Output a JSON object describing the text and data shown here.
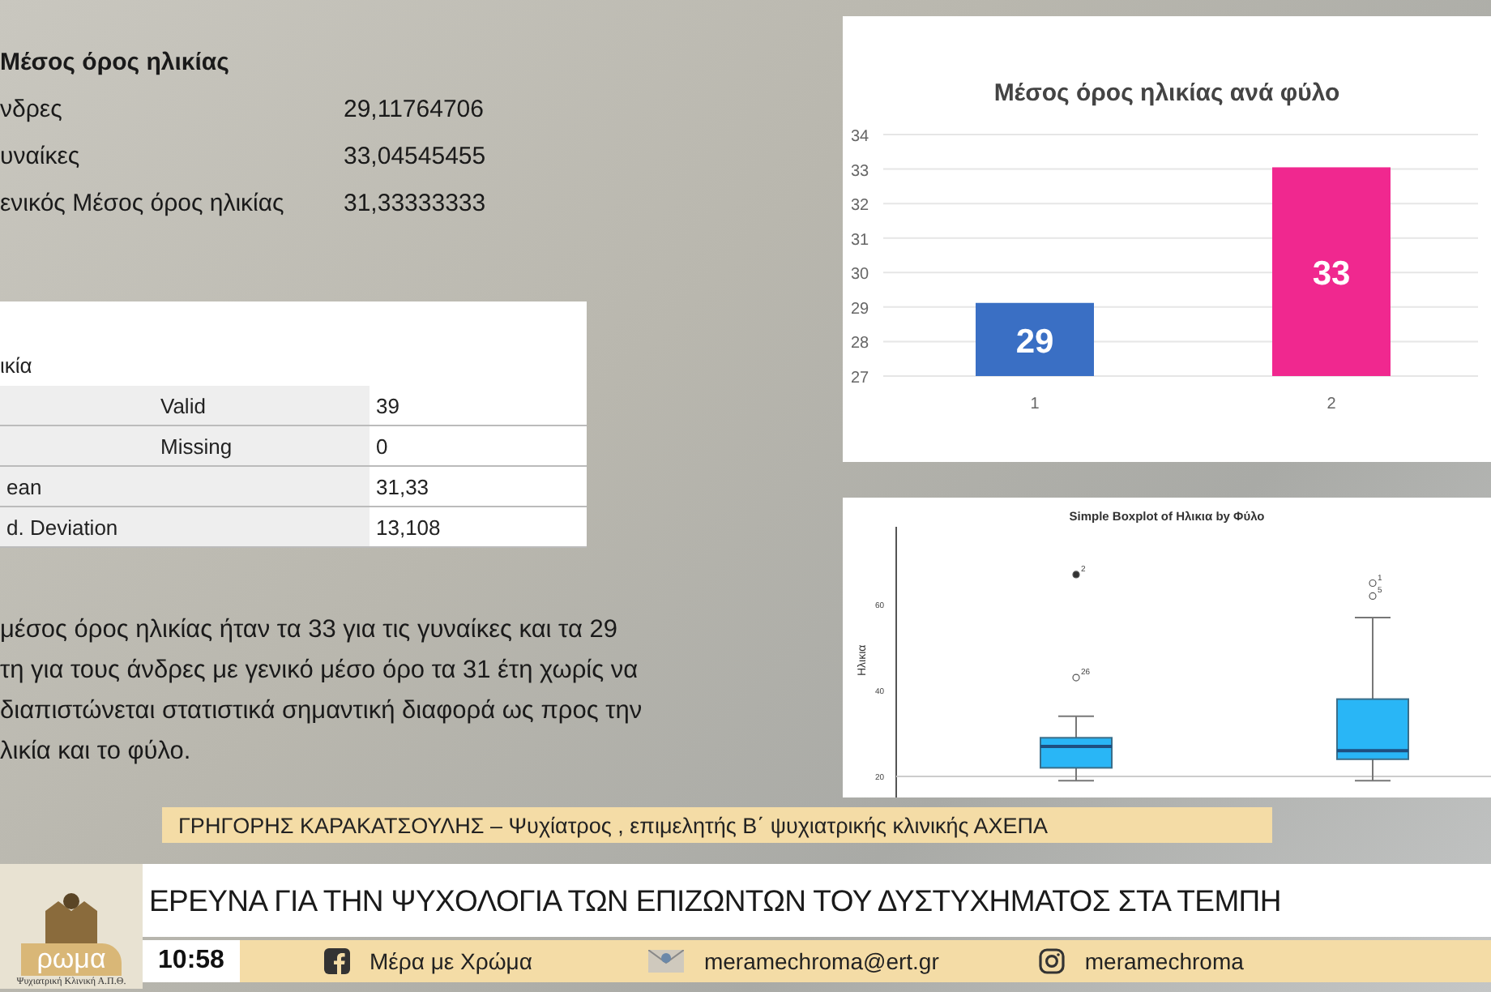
{
  "stats": {
    "title": "Μέσος όρος ηλικίας",
    "rows": [
      {
        "label": "νδρες",
        "value": "29,11764706"
      },
      {
        "label": "υναίκες",
        "value": "33,04545455"
      },
      {
        "label": "ενικός  Μέσος όρος ηλικίας",
        "value": "31,33333333"
      }
    ]
  },
  "table": {
    "title": "ικία",
    "rows": [
      {
        "sub": "Valid",
        "value": "39"
      },
      {
        "sub": "Missing",
        "value": "0"
      },
      {
        "label": "ean",
        "value": "31,33"
      },
      {
        "label": "d. Deviation",
        "value": "13,108"
      }
    ]
  },
  "paragraph": [
    "μέσος όρος ηλικίας ήταν τα 33 για τις γυναίκες και τα 29",
    "τη για τους άνδρες με γενικό μέσο όρο τα 31 έτη χωρίς να",
    "διαπιστώνεται στατιστικά σημαντική διαφορά ως προς την",
    "λικία και το φύλο."
  ],
  "bar_chart": {
    "chart_data": {
      "type": "bar",
      "title": "Μέσος όρος ηλικίας ανά φύλο",
      "categories": [
        "1",
        "2"
      ],
      "values": [
        29.12,
        33.05
      ],
      "colors": [
        "#3a6fc4",
        "#f0288f"
      ],
      "ylim": [
        27,
        34
      ],
      "yticks": [
        27,
        28,
        29,
        30,
        31,
        32,
        33,
        34
      ],
      "grid": true,
      "value_labels": [
        "29",
        "33"
      ]
    }
  },
  "boxplot": {
    "title": "Simple Boxplot of Ηλικια by Φύλο",
    "ylabel": "Ηλικια",
    "yticks": [
      "60",
      "40",
      "20"
    ],
    "outlier_labels": [
      "2",
      "26",
      "1",
      "5"
    ]
  },
  "name_strap": "ΓΡΗΓΟΡΗΣ ΚΑΡΑΚΑΤΣΟΥΛΗΣ – Ψυχίατρος , επιμελητής Β΄ ψυχιατρικής κλινικής ΑΧΕΠΑ",
  "headline": "ΕΡΕΥΝΑ ΓΙΑ ΤΗΝ ΨΥΧΟΛΟΓΙΑ ΤΩΝ ΕΠΙΖΩΝΤΩΝ ΤΟΥ ΔΥΣΤΥΧΗΜΑΤΟΣ ΣΤΑ ΤΕΜΠΗ",
  "logo": {
    "text": "ρωμα",
    "caption": "Ψυχιατρική Κλινική Α.Π.Θ."
  },
  "footer": {
    "time": "10:58",
    "facebook": "Μέρα με Χρώμα",
    "email": "meramechroma@ert.gr",
    "instagram": "meramechroma"
  }
}
